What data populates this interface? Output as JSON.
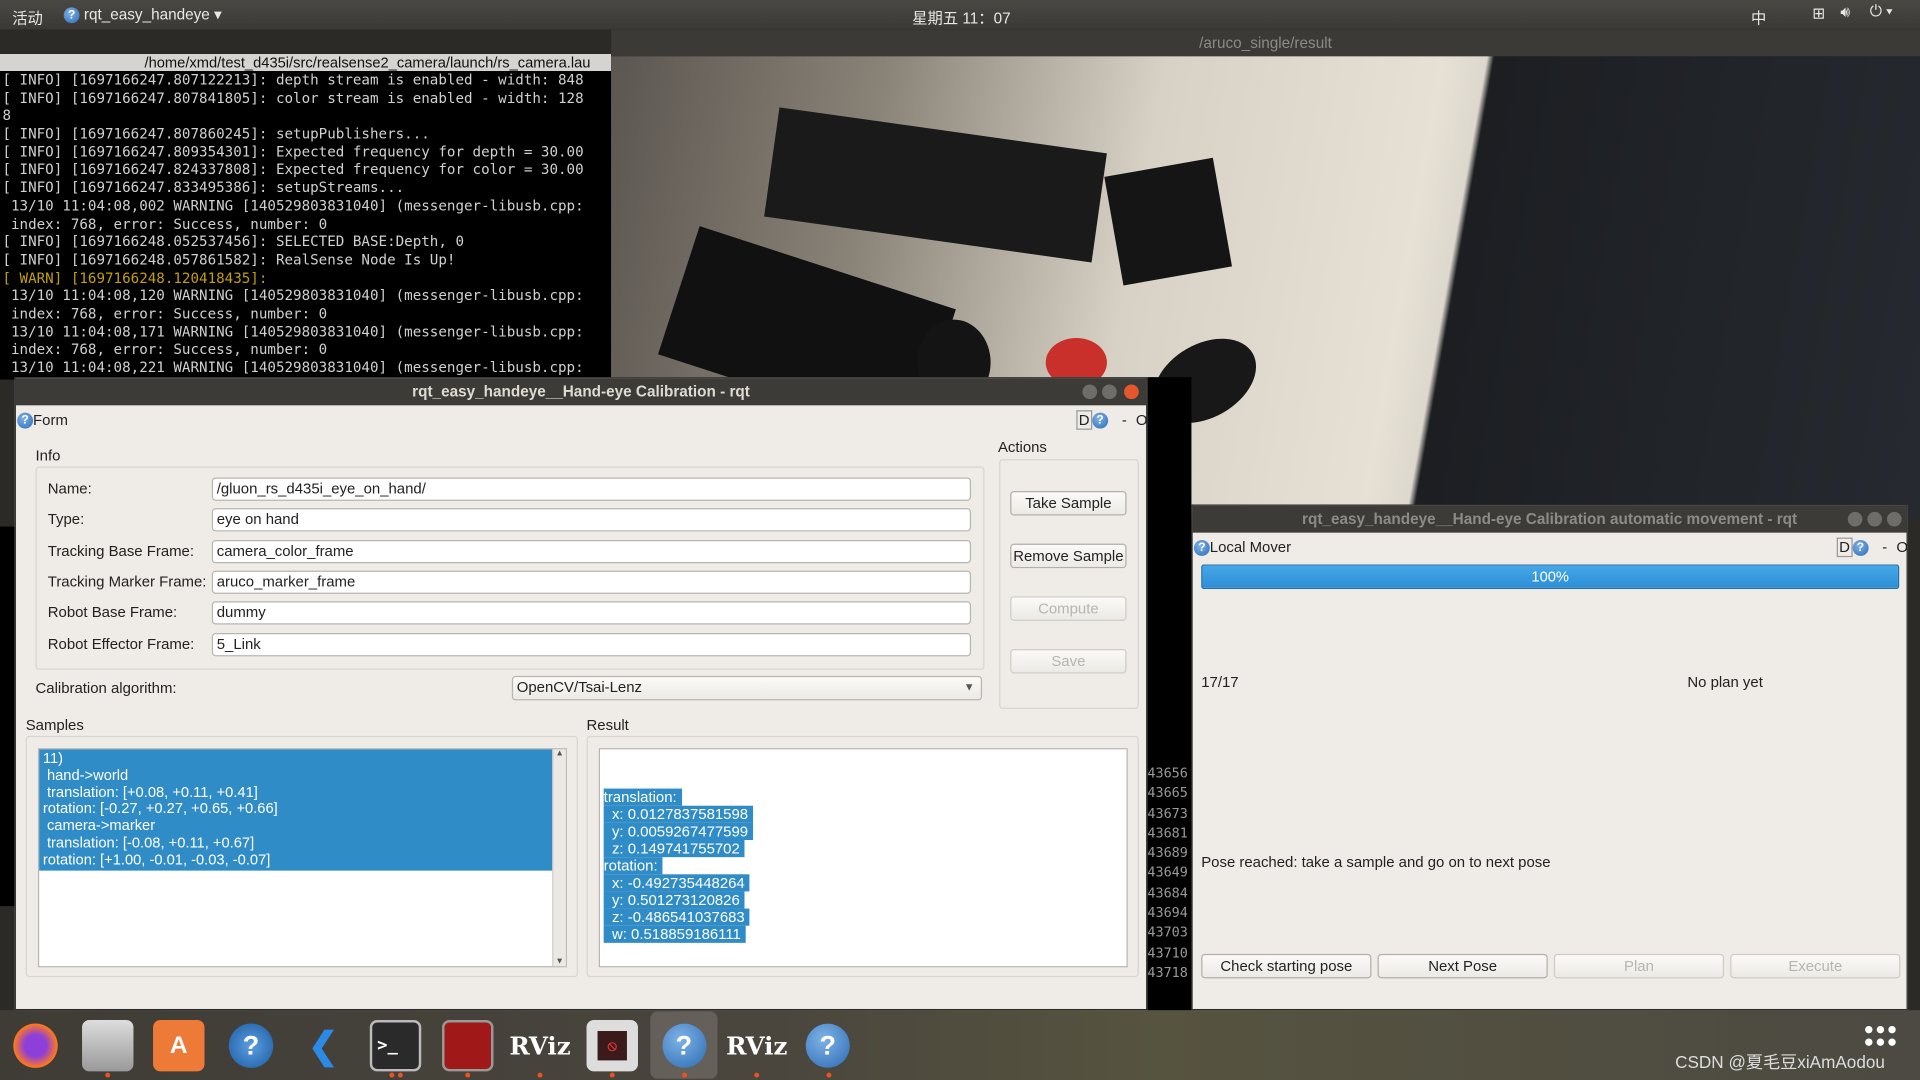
{
  "topbar": {
    "activities": "活动",
    "app_name": "rqt_easy_handeye",
    "clock": "星期五 11：07",
    "input_method": "中"
  },
  "terminal": {
    "title": "/home/xmd/test_d435i/src/realsense2_camera/launch/rs_camera.lau",
    "lines": [
      {
        "t": "[ INFO] [1697166247.807122213]: depth stream is enabled - width: 848",
        "w": false
      },
      {
        "t": "[ INFO] [1697166247.807841805]: color stream is enabled - width: 128",
        "w": false
      },
      {
        "t": "8",
        "w": false
      },
      {
        "t": "[ INFO] [1697166247.807860245]: setupPublishers...",
        "w": false
      },
      {
        "t": "[ INFO] [1697166247.809354301]: Expected frequency for depth = 30.00",
        "w": false
      },
      {
        "t": "[ INFO] [1697166247.824337808]: Expected frequency for color = 30.00",
        "w": false
      },
      {
        "t": "[ INFO] [1697166247.833495386]: setupStreams...",
        "w": false
      },
      {
        "t": " 13/10 11:04:08,002 WARNING [140529803831040] (messenger-libusb.cpp:",
        "w": false
      },
      {
        "t": " index: 768, error: Success, number: 0",
        "w": false
      },
      {
        "t": "[ INFO] [1697166248.052537456]: SELECTED BASE:Depth, 0",
        "w": false
      },
      {
        "t": "[ INFO] [1697166248.057861582]: RealSense Node Is Up!",
        "w": false
      },
      {
        "t": "[ WARN] [1697166248.120418435]:",
        "w": true
      },
      {
        "t": " 13/10 11:04:08,120 WARNING [140529803831040] (messenger-libusb.cpp:",
        "w": false
      },
      {
        "t": " index: 768, error: Success, number: 0",
        "w": false
      },
      {
        "t": " 13/10 11:04:08,171 WARNING [140529803831040] (messenger-libusb.cpp:",
        "w": false
      },
      {
        "t": " index: 768, error: Success, number: 0",
        "w": false
      },
      {
        "t": " 13/10 11:04:08,221 WARNING [140529803831040] (messenger-libusb.cpp:",
        "w": false
      }
    ]
  },
  "camera_window": {
    "title": "/aruco_single/result"
  },
  "side_terminal": {
    "numbers": [
      "43656",
      "43665",
      "43673",
      "43681",
      "43689",
      "43649",
      "43684",
      "43694",
      "43703",
      "43710",
      "43718"
    ]
  },
  "calibration_window": {
    "title": "rqt_easy_handeye__Hand-eye Calibration - rqt",
    "plugin": "Form",
    "plugin_controls": {
      "d": "D",
      "dash": "-",
      "o": "O"
    },
    "info_label": "Info",
    "fields": [
      {
        "label": "Name:",
        "value": "/gluon_rs_d435i_eye_on_hand/"
      },
      {
        "label": "Type:",
        "value": "eye on hand"
      },
      {
        "label": "Tracking Base Frame:",
        "value": "camera_color_frame"
      },
      {
        "label": "Tracking Marker Frame:",
        "value": "aruco_marker_frame"
      },
      {
        "label": "Robot Base Frame:",
        "value": "dummy"
      },
      {
        "label": "Robot Effector Frame:",
        "value": "5_Link"
      }
    ],
    "algorithm_label": "Calibration algorithm:",
    "algorithm_value": "OpenCV/Tsai-Lenz",
    "actions_label": "Actions",
    "actions": {
      "take_sample": "Take Sample",
      "remove_sample": "Remove Sample",
      "compute": "Compute",
      "save": "Save"
    },
    "samples_label": "Samples",
    "samples": [
      "11)",
      " hand->world",
      " translation: [+0.08, +0.11, +0.41]",
      "rotation: [-0.27, +0.27, +0.65, +0.66]",
      " camera->marker",
      " translation: [-0.08, +0.11, +0.67]",
      "rotation: [+1.00, -0.01, -0.03, -0.07]"
    ],
    "result_label": "Result",
    "result": [
      "translation:",
      "  x: 0.0127837581598",
      "  y: 0.0059267477599",
      "  z: 0.149741755702",
      "rotation:",
      "  x: -0.492735448264",
      "  y: 0.501273120826",
      "  z: -0.486541037683",
      "  w: 0.518859186111"
    ]
  },
  "mover_window": {
    "title": "rqt_easy_handeye__Hand-eye Calibration automatic movement - rqt",
    "plugin": "Local Mover",
    "plugin_controls": {
      "d": "D",
      "dash": "-",
      "o": "O"
    },
    "progress": 100,
    "progress_text": "100%",
    "counter": "17/17",
    "plan_status": "No plan yet",
    "message": "Pose reached: take a sample and go on to next pose",
    "buttons": {
      "check": "Check starting pose",
      "next": "Next Pose",
      "plan": "Plan",
      "execute": "Execute"
    }
  },
  "taskbar": {
    "apps": [
      "firefox",
      "files",
      "software-center",
      "help",
      "vscode",
      "terminal",
      "system-monitor",
      "rviz",
      "recorder",
      "rqt-help",
      "rviz",
      "help"
    ],
    "rviz_label": "RViz",
    "watermark": "CSDN @夏毛豆xiAmAodou"
  },
  "colors": {
    "selection": "#308cc6",
    "close": "#e4572e",
    "warn": "#c4a000"
  }
}
